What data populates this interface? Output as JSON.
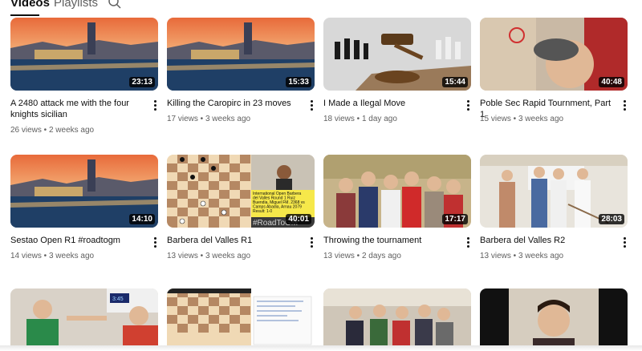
{
  "tabs": {
    "videos": "Videos",
    "playlists": "Playlists"
  },
  "videos": [
    {
      "title": "A 2480 attack me with the four knights sicilian",
      "views": "26 views",
      "age": "2 weeks ago",
      "duration": "23:13"
    },
    {
      "title": "Killing the Caropirc in 23 moves",
      "views": "17 views",
      "age": "3 weeks ago",
      "duration": "15:33"
    },
    {
      "title": "I Made a Ilegal Move",
      "views": "18 views",
      "age": "1 day ago",
      "duration": "15:44"
    },
    {
      "title": "Poble Sec Rapid Tournment, Part 1",
      "views": "15 views",
      "age": "3 weeks ago",
      "duration": "40:48"
    },
    {
      "title": "Sestao Open R1 #roadtogm",
      "views": "14 views",
      "age": "3 weeks ago",
      "duration": "14:10"
    },
    {
      "title": "Barbera del Valles R1",
      "views": "13 views",
      "age": "3 weeks ago",
      "duration": "40:01"
    },
    {
      "title": "Throwing the tournament",
      "views": "13 views",
      "age": "2 days ago",
      "duration": "17:17"
    },
    {
      "title": "Barbera del Valles R2",
      "views": "13 views",
      "age": "3 weeks ago",
      "duration": "28:03"
    },
    {
      "duration": ""
    },
    {
      "duration": ""
    },
    {
      "duration": ""
    },
    {
      "duration": ""
    }
  ],
  "thumb_text": {
    "v6_caption": "International Open Barbera del Valles Round 1 Ruiz Buendia, Miguel FM. 2368 vs Camps Abadia, Arnau 2079 Result: 1-0",
    "v6_tag": "#RoadToGM",
    "v9_clock": "3:45"
  },
  "colors": {
    "accent": "#0f0f0f",
    "secondary_text": "#606060"
  }
}
